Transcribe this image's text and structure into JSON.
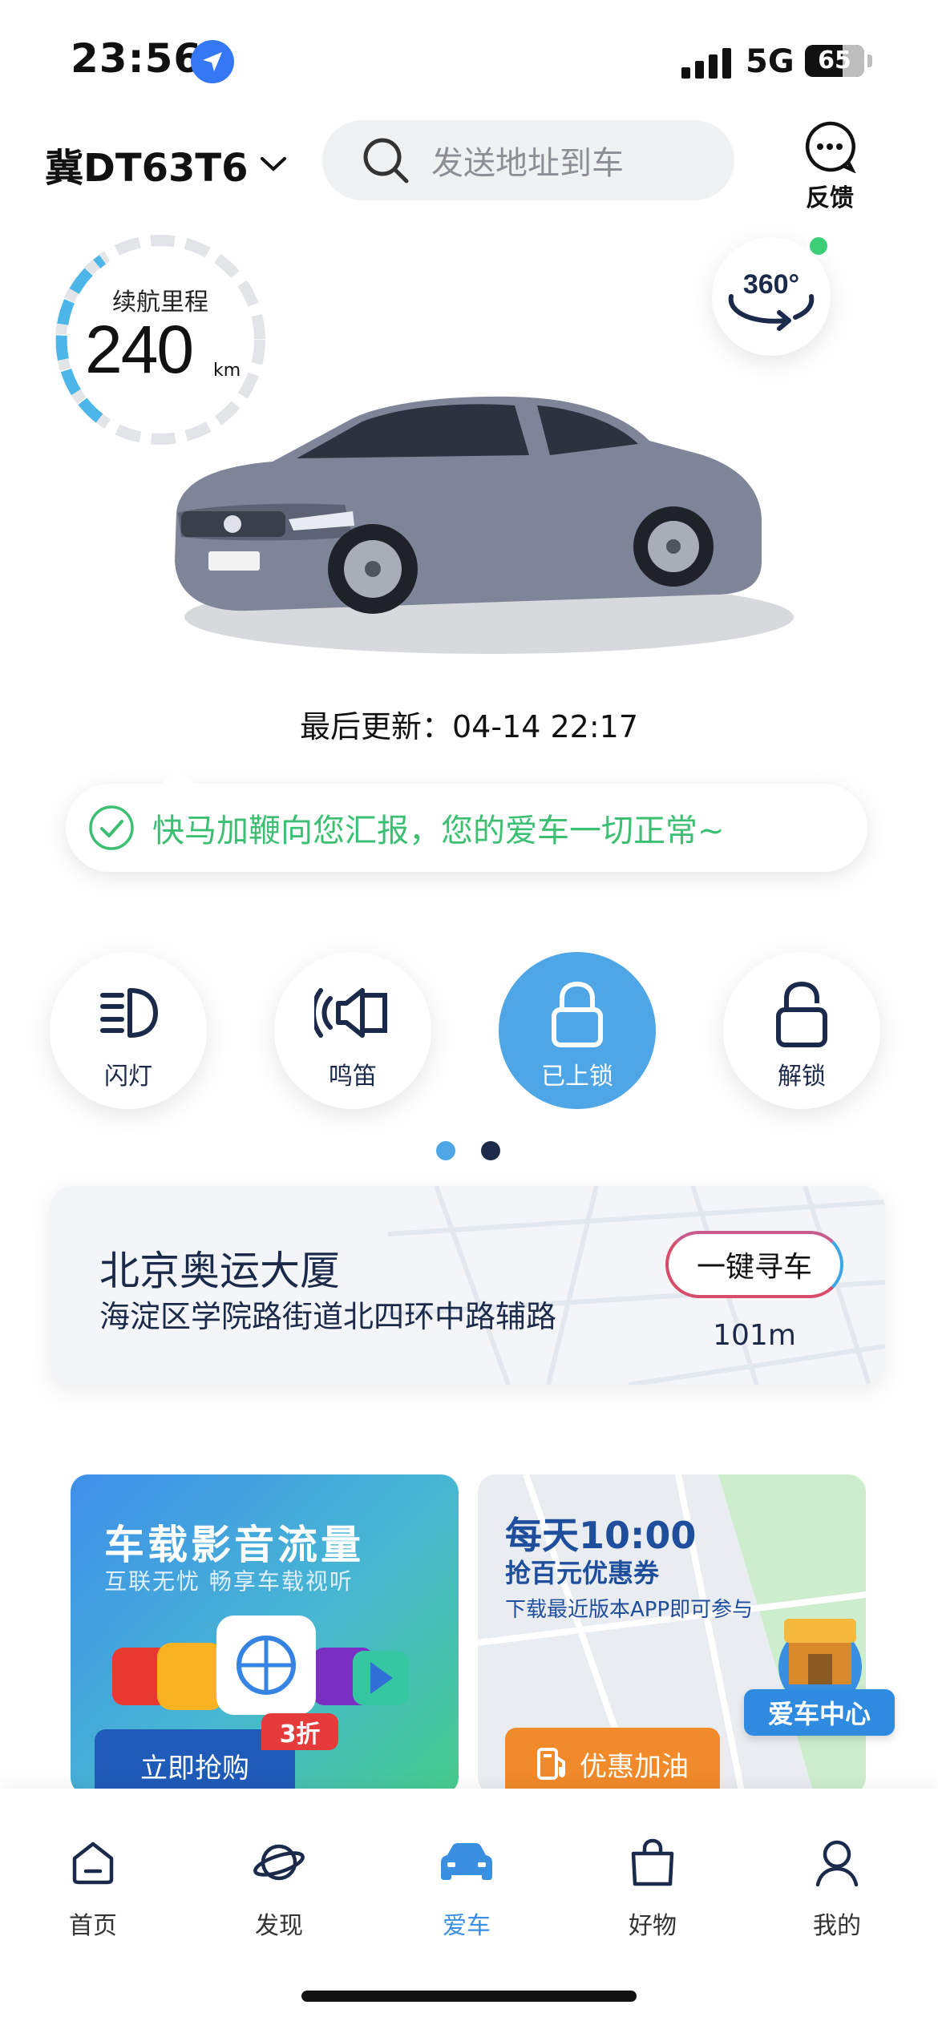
{
  "status_bar": {
    "time": "23:56",
    "network": "5G",
    "battery": "65"
  },
  "header": {
    "plate": "冀DT63T6",
    "search_placeholder": "发送地址到车",
    "feedback_label": "反馈"
  },
  "gauge": {
    "title": "续航里程",
    "value": "240",
    "unit": "km",
    "fill_fraction": 0.35
  },
  "view360_label": "360°",
  "last_updated": "最后更新：04-14 22:17",
  "report": "快马加鞭向您汇报，您的爱车一切正常~",
  "controls": [
    {
      "label": "闪灯",
      "icon": "headlight-icon",
      "active": false
    },
    {
      "label": "鸣笛",
      "icon": "horn-icon",
      "active": false
    },
    {
      "label": "已上锁",
      "icon": "lock-closed-icon",
      "active": true
    },
    {
      "label": "解锁",
      "icon": "lock-open-icon",
      "active": false
    }
  ],
  "pager": {
    "count": 2,
    "active_index": 1
  },
  "location": {
    "title": "北京奥运大厦",
    "address": "海淀区学院路街道北四环中路辅路",
    "find_button": "一键寻车",
    "distance": "101m"
  },
  "promo_media": {
    "title": "车载影音流量",
    "subtitle": "互联无忧  畅享车载视听",
    "button": "立即抢购",
    "badge": "3折"
  },
  "promo_fuel": {
    "title": "每天10:00",
    "subtitle": "抢百元优惠券",
    "note": "下载最近版本APP即可参与",
    "button": "优惠加油",
    "center_label": "爱车中心"
  },
  "tabs": [
    {
      "label": "首页",
      "icon": "home-icon",
      "active": false
    },
    {
      "label": "发现",
      "icon": "planet-icon",
      "active": false
    },
    {
      "label": "爱车",
      "icon": "car-icon",
      "active": true
    },
    {
      "label": "好物",
      "icon": "shopping-bag-icon",
      "active": false
    },
    {
      "label": "我的",
      "icon": "profile-icon",
      "active": false
    }
  ],
  "colors": {
    "accent_blue": "#4fa6e6",
    "status_green": "#3cbf73",
    "navy_text": "#1b2a4a",
    "fuel_orange": "#f08a2a"
  }
}
